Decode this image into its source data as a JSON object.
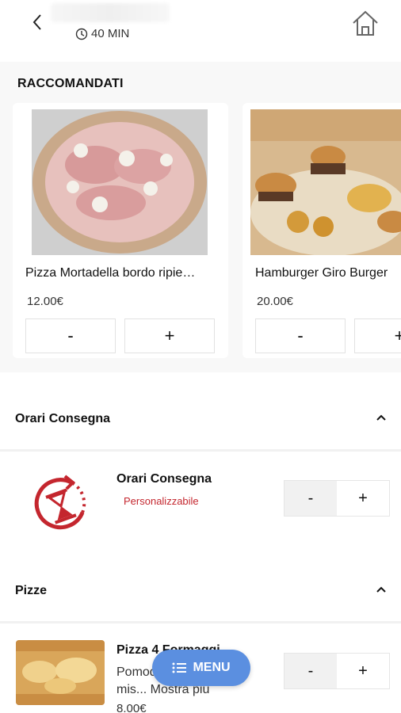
{
  "header": {
    "store_name": "",
    "eta": "40 MIN"
  },
  "recommended": {
    "title": "RACCOMANDATI",
    "items": [
      {
        "name": "Pizza Mortadella bordo ripie…",
        "price": "12.00€",
        "minus": "-",
        "plus": "+"
      },
      {
        "name": "Hamburger Giro Burger",
        "price": "20.00€",
        "minus": "-",
        "plus": "+"
      }
    ]
  },
  "sections": [
    {
      "title": "Orari Consegna",
      "product": {
        "name": "Orari Consegna",
        "tag": "Personalizzabile",
        "minus": "-",
        "plus": "+"
      }
    },
    {
      "title": "Pizze",
      "product": {
        "name": "Pizza 4 Formaggi",
        "description_line1": "Pomodoro, mozzarella,",
        "description_line2": "mis... Mostra più",
        "price": "8.00€",
        "minus": "-",
        "plus": "+"
      }
    }
  ],
  "fab": {
    "label": "MENU"
  },
  "colors": {
    "accent": "#c4262e",
    "fab": "#5b8fe0"
  }
}
